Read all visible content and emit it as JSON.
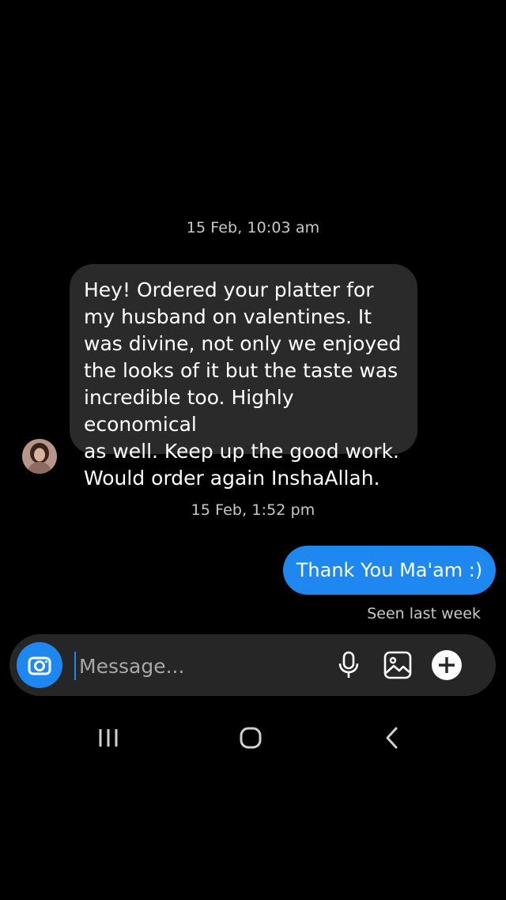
{
  "conversation": {
    "timestamp_1": "15 Feb, 10:03 am",
    "timestamp_2": "15 Feb, 1:52 pm",
    "incoming_message": "Hey! Ordered your platter for\nmy husband on valentines. It\nwas divine, not only we enjoyed\nthe looks of it but the taste was\nincredible too. Highly economical\nas well. Keep up the good work.\nWould order again InshaAllah.",
    "outgoing_message": "Thank You Ma'am :)",
    "seen_status": "Seen last week"
  },
  "composer": {
    "placeholder": "Message...",
    "value": ""
  },
  "icons": {
    "camera": "camera-icon",
    "mic": "microphone-icon",
    "gallery": "gallery-icon",
    "plus": "plus-icon",
    "recents": "recent-apps-icon",
    "home": "home-icon",
    "back": "back-icon"
  },
  "colors": {
    "background": "#000000",
    "incoming_bubble": "#2a2a2a",
    "outgoing_bubble": "#1e88f0",
    "composer_bg": "#262626",
    "secondary_text": "#c8c8c8"
  }
}
